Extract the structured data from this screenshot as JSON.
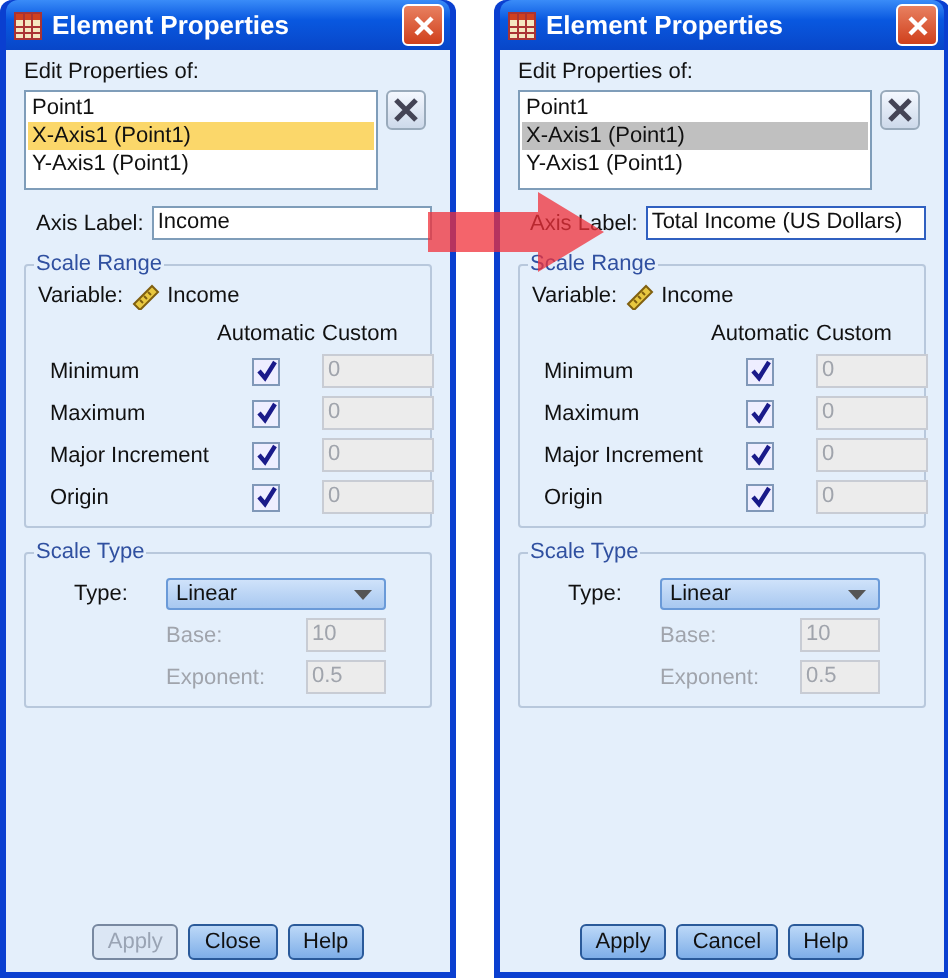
{
  "dialogs": [
    {
      "title": "Element Properties",
      "list_label": "Edit Properties of:",
      "list_focused": true,
      "items": [
        {
          "label": "Point1",
          "selected": false
        },
        {
          "label": "X-Axis1 (Point1)",
          "selected": true
        },
        {
          "label": "Y-Axis1 (Point1)",
          "selected": false
        }
      ],
      "axis_label": {
        "caption": "Axis Label:",
        "value": "Income",
        "focused": false
      },
      "scale_range": {
        "title": "Scale Range",
        "variable_caption": "Variable:",
        "variable": "Income",
        "col_automatic": "Automatic",
        "col_custom": "Custom",
        "rows": [
          {
            "label": "Minimum",
            "checked": true,
            "value": "0"
          },
          {
            "label": "Maximum",
            "checked": true,
            "value": "0"
          },
          {
            "label": "Major Increment",
            "checked": true,
            "value": "0"
          },
          {
            "label": "Origin",
            "checked": true,
            "value": "0"
          }
        ]
      },
      "scale_type": {
        "title": "Scale Type",
        "type_caption": "Type:",
        "type_value": "Linear",
        "base_caption": "Base:",
        "base_value": "10",
        "exponent_caption": "Exponent:",
        "exponent_value": "0.5",
        "disabled": true
      },
      "buttons": [
        {
          "label": "Apply",
          "disabled": true
        },
        {
          "label": "Close",
          "disabled": false
        },
        {
          "label": "Help",
          "disabled": false
        }
      ]
    },
    {
      "title": "Element Properties",
      "list_label": "Edit Properties of:",
      "list_focused": false,
      "items": [
        {
          "label": "Point1",
          "selected": false
        },
        {
          "label": "X-Axis1 (Point1)",
          "selected": true
        },
        {
          "label": "Y-Axis1 (Point1)",
          "selected": false
        }
      ],
      "axis_label": {
        "caption": "Axis Label:",
        "value": "Total Income (US Dollars)",
        "focused": true
      },
      "scale_range": {
        "title": "Scale Range",
        "variable_caption": "Variable:",
        "variable": "Income",
        "col_automatic": "Automatic",
        "col_custom": "Custom",
        "rows": [
          {
            "label": "Minimum",
            "checked": true,
            "value": "0"
          },
          {
            "label": "Maximum",
            "checked": true,
            "value": "0"
          },
          {
            "label": "Major Increment",
            "checked": true,
            "value": "0"
          },
          {
            "label": "Origin",
            "checked": true,
            "value": "0"
          }
        ]
      },
      "scale_type": {
        "title": "Scale Type",
        "type_caption": "Type:",
        "type_value": "Linear",
        "base_caption": "Base:",
        "base_value": "10",
        "exponent_caption": "Exponent:",
        "exponent_value": "0.5",
        "disabled": true
      },
      "buttons": [
        {
          "label": "Apply",
          "disabled": false
        },
        {
          "label": "Cancel",
          "disabled": false
        },
        {
          "label": "Help",
          "disabled": false
        }
      ]
    }
  ]
}
